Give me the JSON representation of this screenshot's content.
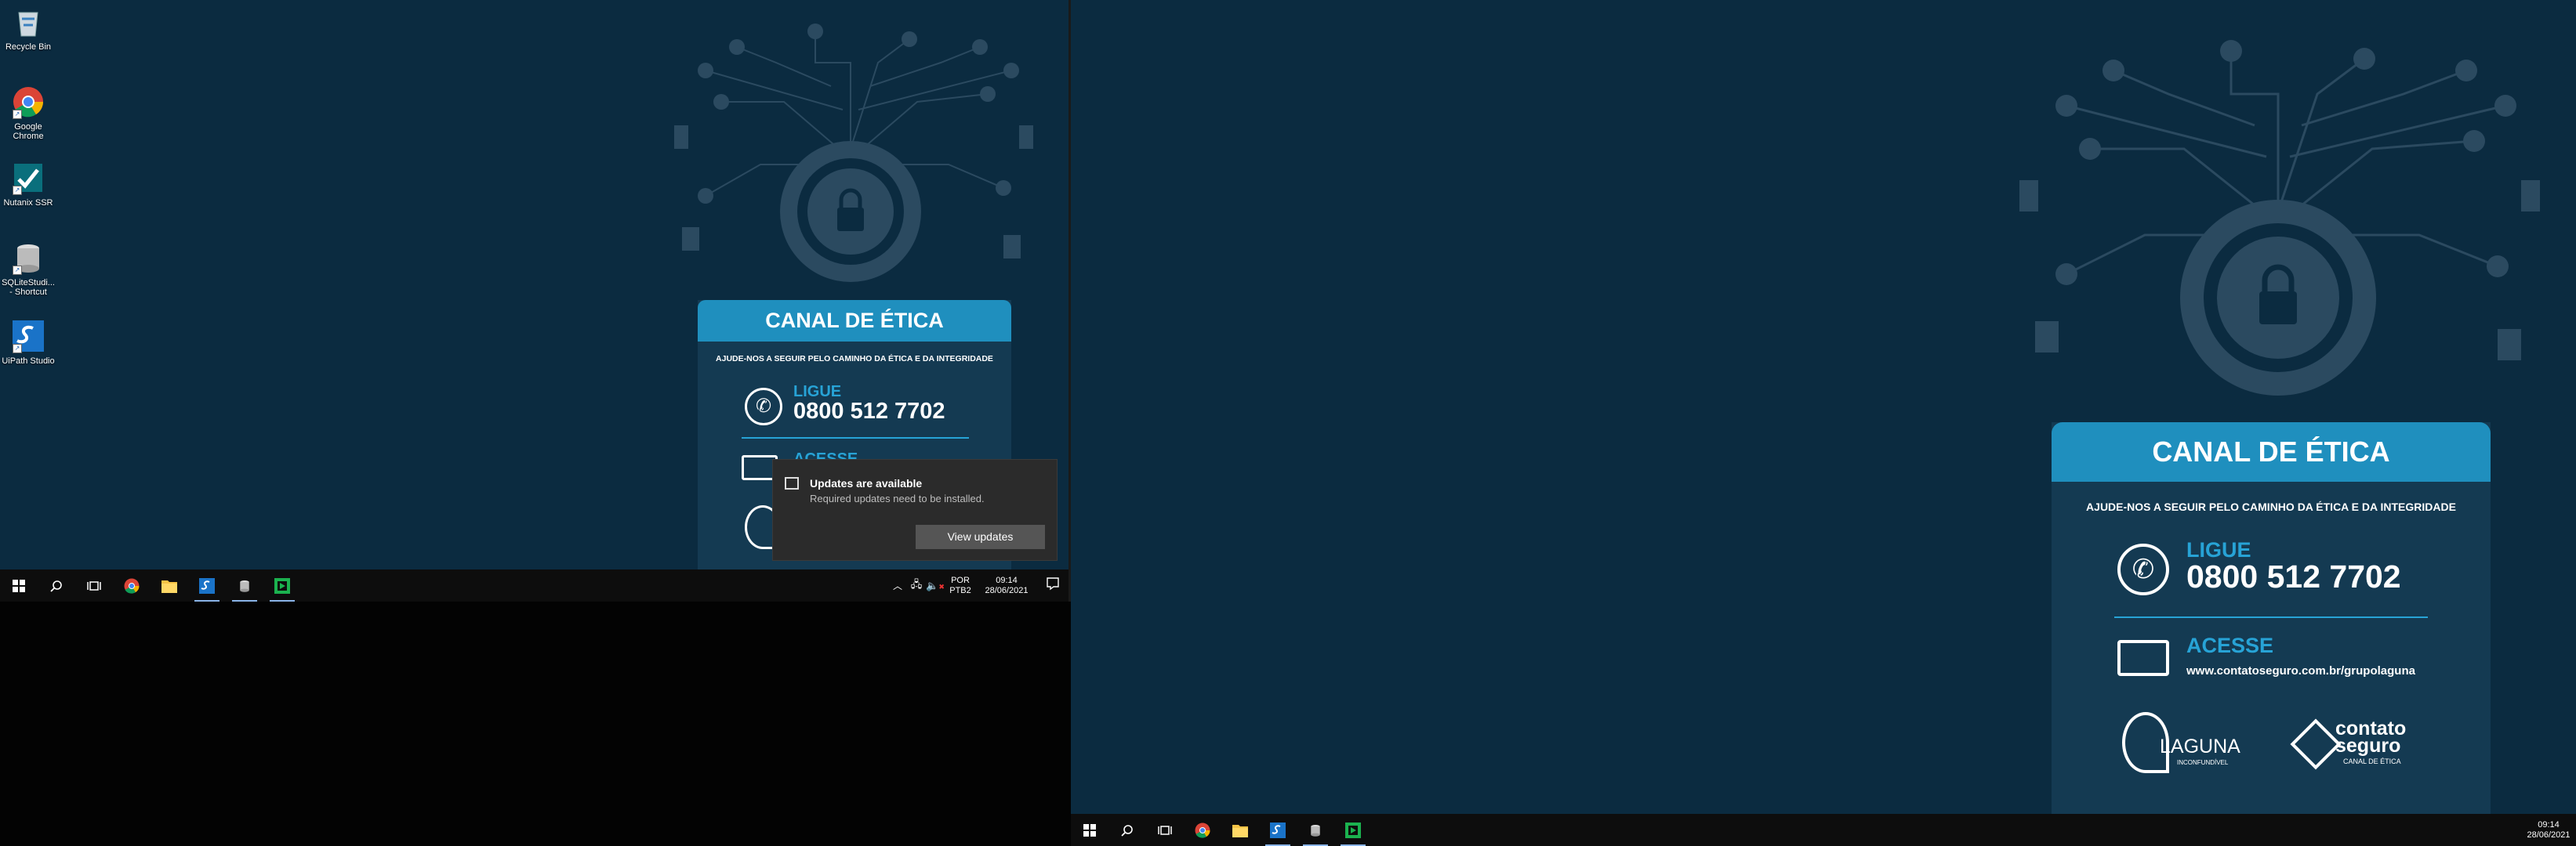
{
  "desktop_icons": [
    {
      "label": "Recycle Bin",
      "icon": "recycle-bin-icon"
    },
    {
      "label": "Google Chrome",
      "icon": "chrome-icon"
    },
    {
      "label": "Nutanix SSR",
      "icon": "nutanix-icon"
    },
    {
      "label": "SQLiteStudi... - Shortcut",
      "icon": "sqlite-icon"
    },
    {
      "label": "UiPath Studio",
      "icon": "uipath-icon"
    }
  ],
  "wallpaper": {
    "title": "CANAL DE ÉTICA",
    "subtitle": "AJUDE-NOS A SEGUIR PELO CAMINHO DA ÉTICA E DA INTEGRIDADE",
    "ligue_label": "LIGUE",
    "phone": "0800 512 7702",
    "acesse_label": "ACESSE",
    "url": "www.contatoseguro.com.br/grupolaguna",
    "logo_laguna": "LAGUNA",
    "logo_laguna_tagline": "INCONFUNDÍVEL",
    "logo_contato": "contato seguro",
    "logo_contato_tagline": "CANAL DE ÉTICA",
    "colors": {
      "background": "#0b2b40",
      "accent": "#1f8fbe"
    }
  },
  "notification": {
    "title": "Updates are available",
    "body": "Required updates need to be installed.",
    "button": "View updates"
  },
  "taskbar": {
    "apps": [
      "start-icon",
      "search-icon",
      "task-view-icon",
      "chrome-icon",
      "file-explorer-icon",
      "uipath-icon",
      "sqlite-icon",
      "green-app-icon"
    ],
    "language_top": "POR",
    "language_bottom": "PTB2",
    "time": "09:14",
    "date": "28/06/2021"
  }
}
